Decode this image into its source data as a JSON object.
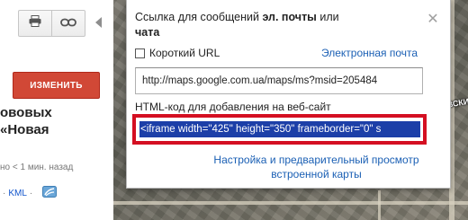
{
  "sidebar": {
    "edit_button": "ИЗМЕНИТЬ",
    "map_title_lines": [
      "ововых",
      "«Новая"
    ],
    "edited_time": "но < 1 мин. назад",
    "kml_prefix": "·",
    "kml_link": "KML",
    "kml_suffix": "·",
    "icons": [
      "print-icon",
      "link-icon",
      "collapse-arrow-icon",
      "rss-icon"
    ]
  },
  "dialog": {
    "title_part1": "Ссылка для сообщений ",
    "title_bold1": "эл. почты",
    "title_part2": " или",
    "title_bold2": "чата",
    "short_url_label": "Короткий URL",
    "short_url_checked": false,
    "email_link": "Электронная почта",
    "url_value": "http://maps.google.com.ua/maps/ms?msid=205484",
    "html_label": "HTML-код для добавления на веб-сайт",
    "embed_code": "<iframe width=\"425\" height=\"350\" frameborder=\"0\" s",
    "customize_link": "Настройка и предварительный просмотр встроенной карты",
    "close_icon": "close-icon"
  },
  "map": {
    "label_fragment": "ВСКИЙ"
  },
  "colors": {
    "edit_button": "#d14836",
    "highlight_border": "#d40f22",
    "selection": "#1c3fa8",
    "link": "#1a5fb4"
  }
}
